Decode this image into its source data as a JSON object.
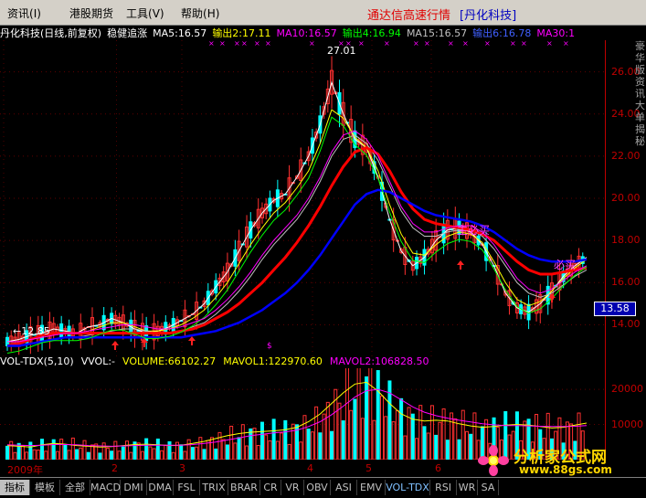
{
  "menu": {
    "items": [
      "资讯",
      "港股期货",
      "工具",
      "帮助"
    ],
    "hotkeys": [
      "(I)",
      "",
      "(V)",
      "(H)"
    ],
    "app_title": "通达信高速行情",
    "stock_title": "[丹化科技]"
  },
  "header": {
    "stock": "丹化科技(日线,前复权)",
    "indicator": "稳健追涨",
    "ma5": "MA5:16.57",
    "out2": "输出2:17.11",
    "ma10": "MA10:16.57",
    "out4": "输出4:16.94",
    "ma15": "MA15:16.57",
    "out6": "输出6:16.78",
    "ma30": "MA30:1"
  },
  "colors": {
    "ma5": "#ffffff",
    "out2": "#ffff00",
    "ma10": "#ff00ff",
    "out4": "#00ff00",
    "ma15": "#c0c0c0",
    "out6": "#0000ff",
    "ma30": "#ff00ff",
    "red_line": "#ff0000",
    "blue_line": "#0000ff",
    "up_candle": "#ff3030",
    "down_candle": "#00ffff",
    "axis": "#c00000"
  },
  "annotations": {
    "high": "27.01",
    "low": "←12.85",
    "current_price": "13.58",
    "signal_buy1": "主必买",
    "signal_buy2": "必买"
  },
  "chart_data": {
    "type": "line",
    "y_axis_ticks": [
      26.0,
      24.0,
      22.0,
      20.0,
      18.0,
      16.0,
      14.0
    ],
    "ylim": [
      12.5,
      27.5
    ],
    "x_labels": [
      "2009年",
      "2",
      "3",
      "4",
      "5",
      "6"
    ],
    "series": [
      {
        "name": "MA5",
        "values": [
          13.2,
          13.3,
          13.5,
          13.6,
          13.8,
          13.7,
          13.6,
          13.9,
          14.0,
          14.3,
          14.1,
          13.8,
          13.6,
          13.7,
          13.9,
          14.2,
          14.5,
          15.0,
          15.8,
          16.5,
          17.5,
          18.5,
          19.3,
          19.9,
          20.2,
          21.0,
          22.0,
          23.5,
          25.5,
          24.0,
          22.8,
          22.4,
          21.0,
          19.0,
          17.5,
          16.8,
          17.2,
          18.0,
          18.5,
          18.6,
          18.4,
          17.8,
          16.8,
          15.5,
          14.8,
          14.6,
          15.0,
          15.6,
          16.3,
          16.8,
          17.2
        ]
      },
      {
        "name": "输出2",
        "values": [
          13.0,
          13.1,
          13.3,
          13.5,
          13.6,
          13.6,
          13.6,
          13.7,
          13.9,
          14.1,
          14.1,
          13.9,
          13.7,
          13.7,
          13.8,
          14.0,
          14.3,
          14.7,
          15.3,
          16.0,
          16.9,
          17.8,
          18.6,
          19.3,
          19.8,
          20.5,
          21.3,
          22.6,
          24.2,
          23.8,
          22.9,
          22.4,
          21.3,
          19.7,
          18.3,
          17.4,
          17.3,
          17.8,
          18.2,
          18.4,
          18.3,
          17.9,
          17.0,
          16.0,
          15.2,
          14.9,
          15.1,
          15.6,
          16.2,
          16.7,
          17.1
        ]
      },
      {
        "name": "MA15",
        "values": [
          13.0,
          13.0,
          13.1,
          13.2,
          13.3,
          13.4,
          13.4,
          13.5,
          13.6,
          13.7,
          13.8,
          13.8,
          13.7,
          13.6,
          13.6,
          13.7,
          13.9,
          14.1,
          14.5,
          15.0,
          15.6,
          16.3,
          17.1,
          17.8,
          18.4,
          19.0,
          19.8,
          20.8,
          22.0,
          22.8,
          23.0,
          22.6,
          21.8,
          20.6,
          19.4,
          18.6,
          18.2,
          18.2,
          18.4,
          18.5,
          18.5,
          18.2,
          17.6,
          16.8,
          16.0,
          15.5,
          15.3,
          15.5,
          15.9,
          16.3,
          16.6
        ]
      },
      {
        "name": "红线",
        "values": [
          13.0,
          13.1,
          13.3,
          13.5,
          13.6,
          13.6,
          13.6,
          13.6,
          13.6,
          13.6,
          13.6,
          13.6,
          13.6,
          13.6,
          13.6,
          13.7,
          13.8,
          14.0,
          14.3,
          14.6,
          15.0,
          15.5,
          16.0,
          16.6,
          17.2,
          17.9,
          18.7,
          19.6,
          20.6,
          21.5,
          22.2,
          22.4,
          22.1,
          21.3,
          20.3,
          19.5,
          19.0,
          18.8,
          18.7,
          18.6,
          18.5,
          18.3,
          18.0,
          17.5,
          17.0,
          16.6,
          16.4,
          16.4,
          16.5,
          16.6,
          16.7
        ]
      },
      {
        "name": "蓝线",
        "values": [
          13.0,
          13.0,
          13.1,
          13.2,
          13.3,
          13.4,
          13.4,
          13.4,
          13.4,
          13.4,
          13.4,
          13.4,
          13.4,
          13.4,
          13.4,
          13.4,
          13.5,
          13.6,
          13.7,
          13.9,
          14.1,
          14.4,
          14.7,
          15.1,
          15.5,
          16.0,
          16.6,
          17.3,
          18.1,
          18.9,
          19.7,
          20.2,
          20.4,
          20.3,
          20.0,
          19.7,
          19.4,
          19.2,
          19.1,
          19.0,
          18.9,
          18.7,
          18.4,
          18.0,
          17.6,
          17.3,
          17.1,
          17.0,
          17.0,
          17.0,
          17.1
        ]
      }
    ],
    "volume": {
      "title": "VOL-TDX(5,10)",
      "vvol": "VVOL:-",
      "volume_label": "VOLUME:66102.27",
      "mavol1": "MAVOL1:122970.60",
      "mavol2": "MAVOL2:106828.50",
      "y_ticks": [
        20000,
        10000
      ],
      "mavol1_values": [
        4000,
        3800,
        3600,
        4200,
        4600,
        4400,
        4000,
        3800,
        3600,
        3700,
        4000,
        4300,
        4400,
        4200,
        4000,
        4100,
        4600,
        5200,
        6000,
        6800,
        7400,
        7800,
        8000,
        8200,
        8500,
        9200,
        10800,
        13000,
        16000,
        19000,
        21500,
        22000,
        19500,
        16000,
        13000,
        11500,
        11000,
        11200,
        11000,
        10200,
        9600,
        9200,
        9400,
        9800,
        10000,
        9800,
        9400,
        9000,
        9200,
        9800,
        10400
      ],
      "mavol2_values": [
        4200,
        4100,
        4000,
        4100,
        4300,
        4300,
        4200,
        4000,
        3900,
        3800,
        3900,
        4000,
        4100,
        4100,
        4100,
        4100,
        4300,
        4600,
        5000,
        5600,
        6200,
        6800,
        7200,
        7600,
        7900,
        8400,
        9400,
        10800,
        12800,
        15200,
        17800,
        19600,
        20000,
        19000,
        17000,
        15000,
        13500,
        12500,
        11800,
        11200,
        10700,
        10200,
        9900,
        9700,
        9700,
        9600,
        9500,
        9400,
        9400,
        9500,
        9700
      ]
    }
  },
  "tabs": [
    "指标",
    "模板",
    "全部",
    "MACD",
    "DMI",
    "DMA",
    "FSL",
    "TRIX",
    "BRAR",
    "CR",
    "VR",
    "OBV",
    "ASI",
    "EMV",
    "VOL-TDX",
    "RSI",
    "WR",
    "SA"
  ],
  "side_text": "豪华版资讯大单揭秘",
  "watermark": {
    "brand": "分析家公式网",
    "url": "www.88gs.com"
  }
}
